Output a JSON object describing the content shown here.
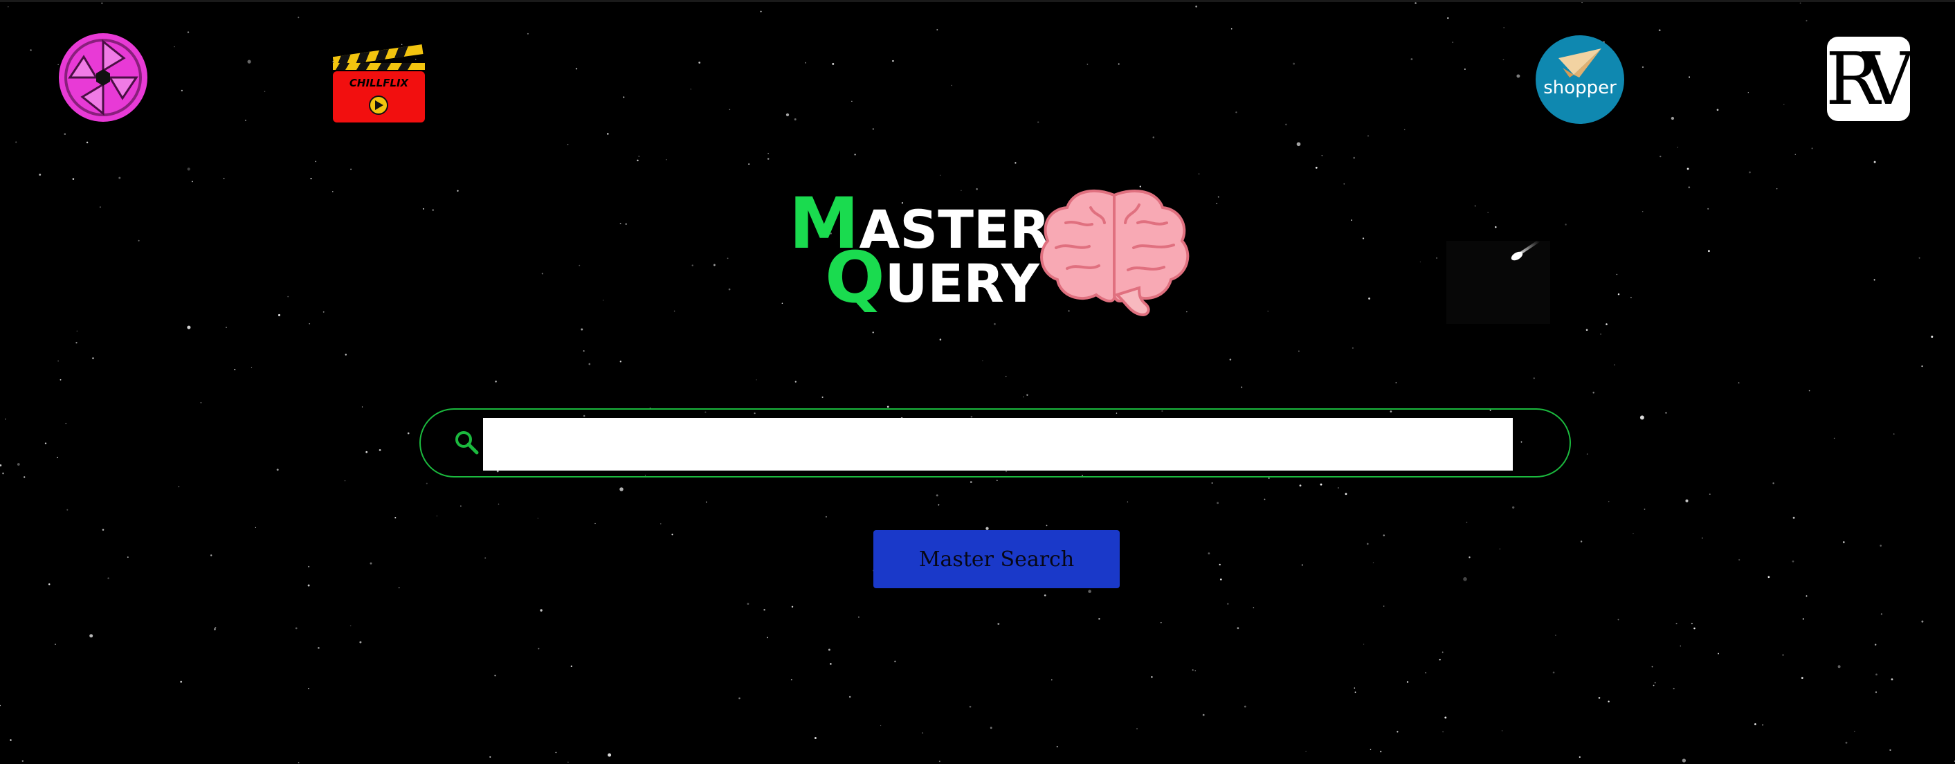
{
  "app": {
    "logo": {
      "line1_first": "M",
      "line1_rest": "ASTER",
      "line2_first": "Q",
      "line2_rest": "UERY",
      "icon": "brain-icon"
    },
    "decoration_icons": [
      "comet-icon"
    ]
  },
  "corner_links": {
    "aperture": {
      "icon": "aperture-icon"
    },
    "chillflix": {
      "label": "CHILLFLIX",
      "icon": "clapperboard-icon"
    },
    "shopper": {
      "label": "shopper",
      "icon": "paper-plane-icon"
    },
    "rv": {
      "label": "RV"
    }
  },
  "search": {
    "placeholder": "",
    "value": "",
    "icon": "search-icon",
    "button_label": "Master Search"
  },
  "colors": {
    "background": "#000000",
    "accent_green": "#1adb4f",
    "search_border": "#1bb93e",
    "button": "#1a39c9",
    "aperture_pink": "#e83ad6",
    "chillflix_red": "#f20f0f",
    "shopper_teal": "#0f88b0"
  }
}
